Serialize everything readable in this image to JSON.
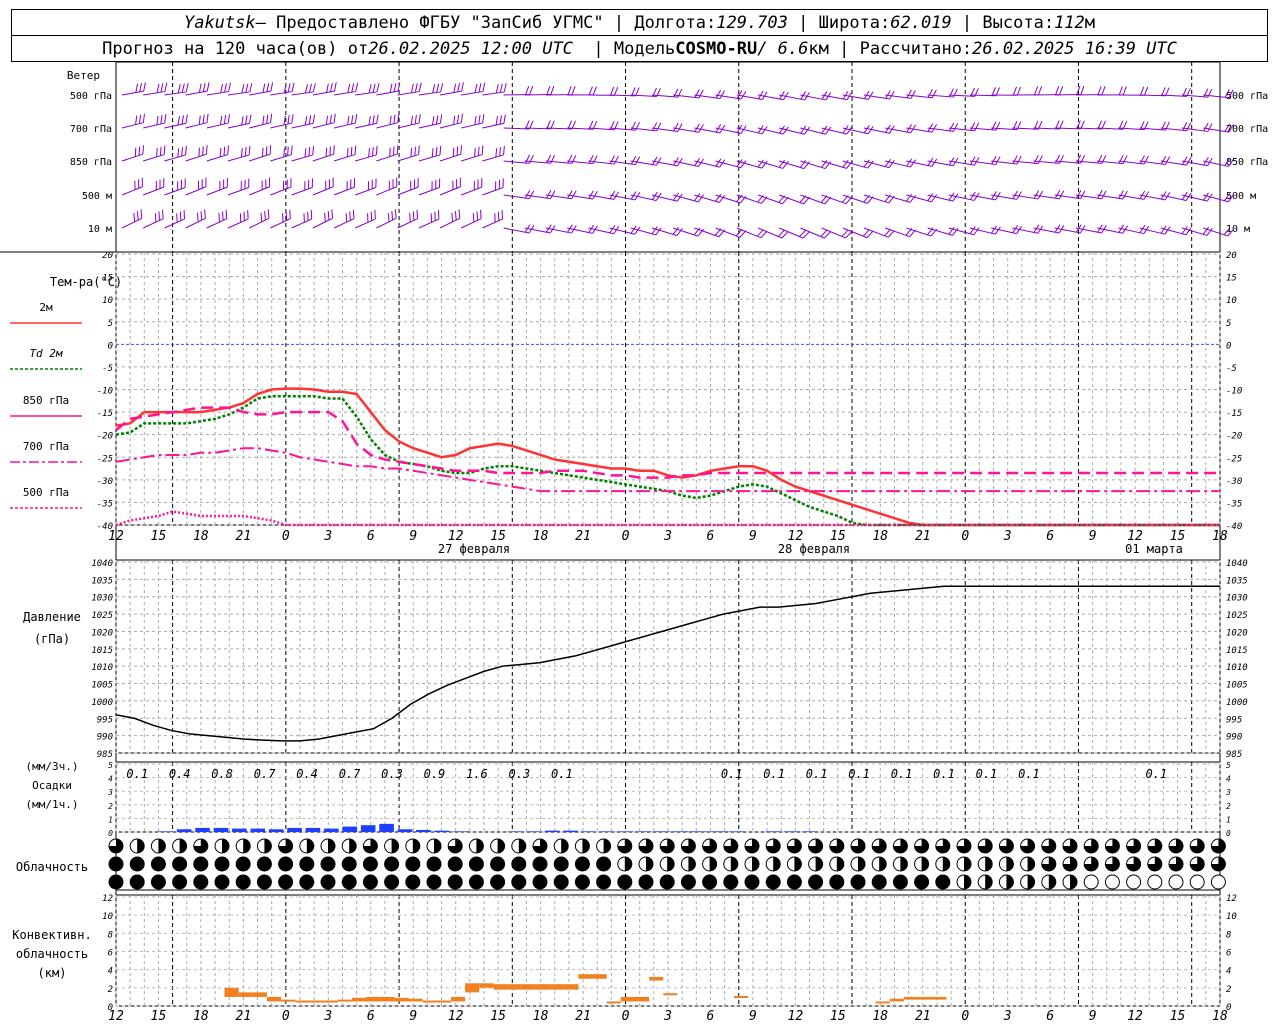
{
  "header": {
    "station": "Yakutsk",
    "provided_by": "— Предоставлено ФГБУ \"ЗапСиб УГМС\"",
    "lon_label": "Долгота:",
    "lon_value": "129.703",
    "lat_label": "Широта:",
    "lat_value": "62.019",
    "alt_label": "Высота:",
    "alt_value": "112",
    "alt_unit": "м",
    "forecast_label": "Прогноз на 120 часа(ов) от",
    "forecast_start": "26.02.2025 12:00 UTC",
    "model_label": "Модель",
    "model_name": "COSMO-RU",
    "model_res": "/ 6.6",
    "model_res_unit": "км",
    "calc_label": "Рассчитано:",
    "calc_time": "26.02.2025 16:39 UTC"
  },
  "colors": {
    "t2m": "#ff3333",
    "td2m": "#008000",
    "t850": "#ff1493",
    "t700": "#ff1493",
    "t500": "#ff1493",
    "pressure": "#000000",
    "precip": "#1f3fff",
    "convective": "#f08020",
    "wind": "#8800cc",
    "zero_line": "#3355ff"
  },
  "wind_panel": {
    "title": "Ветер",
    "levels": [
      "500 гПа",
      "700 гПа",
      "850 гПа",
      "500 м",
      "10  м"
    ],
    "right_levels": [
      "500 гПа",
      "700 гПа",
      "850 гПа",
      "500 м",
      "10  м"
    ]
  },
  "temp_legend": {
    "title": "Тем-ра(°C)",
    "items": [
      "2м",
      "Td  2м",
      "850 гПа",
      "700 гПа",
      "500 гПа"
    ]
  },
  "pressure_panel": {
    "title1": "Давление",
    "title2": "(гПа)"
  },
  "precip_panel": {
    "unit3h": "(мм/3ч.)",
    "title": "Осадки",
    "unit1h": "(мм/1ч.)"
  },
  "cloud_panel": {
    "title": "Облачность"
  },
  "conv_panel": {
    "title1": "Конвективн.",
    "title2": "облачность",
    "title3": "(км)"
  },
  "time_axis": {
    "hour_labels": [
      "12",
      "15",
      "18",
      "21",
      "0",
      "3",
      "6",
      "9",
      "12",
      "15",
      "18",
      "21",
      "0",
      "3",
      "6",
      "9",
      "12",
      "15",
      "18",
      "21",
      "0",
      "3",
      "6",
      "9",
      "12",
      "15",
      "18"
    ],
    "date_labels": [
      "27 февраля",
      "28 февраля",
      "01 марта"
    ]
  },
  "precip_3h_labels": [
    "0.1",
    "0.4",
    "0.8",
    "0.7",
    "0.4",
    "0.7",
    "0.3",
    "0.9",
    "1.6",
    "0.3",
    "0.1",
    "",
    "",
    "",
    "0.1",
    "0.1",
    "0.1",
    "0.1",
    "0.1",
    "0.1",
    "0.1",
    "0.1",
    "",
    "",
    "0.1",
    "",
    ""
  ],
  "chart_data": [
    {
      "type": "line",
      "name": "temperature",
      "x_hours": [
        0,
        3,
        6,
        9,
        12,
        15,
        18,
        21,
        24,
        27,
        30,
        33,
        36,
        39,
        42,
        45,
        48,
        51,
        54,
        57,
        60,
        63,
        66,
        69,
        72,
        75,
        78,
        81,
        84,
        87,
        90,
        93,
        96,
        99,
        102,
        105,
        108,
        111,
        114,
        117,
        120,
        123,
        126,
        129,
        132,
        135,
        138,
        141,
        144,
        147,
        150,
        153,
        156,
        159,
        162,
        165,
        168,
        171,
        174,
        177,
        180,
        183,
        186,
        189,
        192,
        195,
        198,
        201,
        204,
        207,
        210,
        213,
        216,
        219,
        222,
        225,
        228,
        231,
        234
      ],
      "ylim": [
        -40,
        20
      ],
      "yticks": [
        20,
        15,
        10,
        5,
        0,
        -5,
        -10,
        -15,
        -20,
        -25,
        -30,
        -35,
        -40
      ],
      "series": [
        {
          "name": "2м",
          "values": [
            -18,
            -17.5,
            -15,
            -15,
            -15,
            -15,
            -15,
            -14.5,
            -14,
            -13,
            -11,
            -10,
            -9.8,
            -9.8,
            -10,
            -10.5,
            -10.5,
            -11,
            -15,
            -19,
            -21.5,
            -23,
            -24,
            -25,
            -24.5,
            -23,
            -22.5,
            -22,
            -22.5,
            -23.5,
            -24.5,
            -25.5,
            -26,
            -26.5,
            -27,
            -27.5,
            -27.5,
            -28,
            -28,
            -29,
            -29.5,
            -29,
            -28,
            -27.5,
            -27,
            -27,
            -28,
            -30,
            -31.5,
            -32.5,
            -33.5,
            -34.5,
            -35.5,
            -36.5,
            -37.5,
            -38.5,
            -39.5,
            -40,
            -40,
            -40,
            -40,
            -40,
            -40,
            -40,
            -40,
            -40,
            -40,
            -40,
            -40,
            -40,
            -40,
            -40,
            -40,
            -40,
            -40,
            -40,
            -40,
            -40,
            -40
          ]
        },
        {
          "name": "Td  2м",
          "values": [
            -20,
            -19.5,
            -17.5,
            -17.5,
            -17.5,
            -17.5,
            -17,
            -16.5,
            -15.5,
            -14,
            -12,
            -11.5,
            -11.5,
            -11.5,
            -11.5,
            -12,
            -12,
            -16,
            -21,
            -24.5,
            -26,
            -26.5,
            -27,
            -28,
            -28.5,
            -28.5,
            -27.5,
            -27,
            -27,
            -27.5,
            -28,
            -28.5,
            -29,
            -29.5,
            -30,
            -30.5,
            -31,
            -31.5,
            -32,
            -32.5,
            -33.5,
            -34,
            -33.5,
            -32.5,
            -31.5,
            -31,
            -31.5,
            -33,
            -34.5,
            -36,
            -37,
            -38,
            -39.5,
            -40,
            -40,
            -40,
            -40,
            -40,
            -40,
            -40,
            -40,
            -40,
            -40,
            -40,
            -40,
            -40,
            -40,
            -40,
            -40,
            -40,
            -40,
            -40,
            -40,
            -40,
            -40,
            -40,
            -40,
            -40,
            -40
          ]
        },
        {
          "name": "850 гПа",
          "values": [
            -19,
            -16.5,
            -16,
            -15.5,
            -15,
            -14.5,
            -14,
            -14,
            -14,
            -15,
            -15.5,
            -15.5,
            -15,
            -15,
            -15,
            -15,
            -17,
            -22,
            -24.5,
            -25.5,
            -26,
            -26.5,
            -27,
            -27.5,
            -28,
            -28,
            -28,
            -28.5,
            -28.5,
            -28.5,
            -28.5,
            -28,
            -28,
            -28,
            -28.5,
            -29,
            -29,
            -29.5,
            -29.5,
            -29.5,
            -29,
            -29,
            -28.5,
            -28.5,
            -28.5,
            -28.5,
            -28.5,
            -28.5,
            -28.5,
            -28.5,
            -28.5,
            -28.5,
            -28.5,
            -28.5,
            -28.5,
            -28.5,
            -28.5,
            -28.5,
            -28.5,
            -28.5,
            -28.5,
            -28.5,
            -28.5,
            -28.5,
            -28.5,
            -28.5,
            -28.5,
            -28.5,
            -28.5,
            -28.5,
            -28.5,
            -28.5,
            -28.5,
            -28.5,
            -28.5,
            -28.5,
            -28.5,
            -28.5,
            -28.5
          ]
        },
        {
          "name": "700 гПа",
          "values": [
            -26,
            -25.5,
            -25,
            -24.5,
            -24.5,
            -24.5,
            -24,
            -24,
            -23.5,
            -23,
            -23,
            -23.5,
            -24,
            -25,
            -25.5,
            -26,
            -26.5,
            -27,
            -27,
            -27.5,
            -27.5,
            -28,
            -28.5,
            -29,
            -29.5,
            -30,
            -30.5,
            -31,
            -31.5,
            -32,
            -32.5,
            -32.5,
            -32.5,
            -32.5,
            -32.5,
            -32.5,
            -32.5,
            -32.5,
            -32.5,
            -32.5,
            -32.5,
            -32.5,
            -32.5,
            -32.5,
            -32.5,
            -32.5,
            -32.5,
            -32.5,
            -32.5,
            -32.5,
            -32.5,
            -32.5,
            -32.5,
            -32.5,
            -32.5,
            -32.5,
            -32.5,
            -32.5,
            -32.5,
            -32.5,
            -32.5,
            -32.5,
            -32.5,
            -32.5,
            -32.5,
            -32.5,
            -32.5,
            -32.5,
            -32.5,
            -32.5,
            -32.5,
            -32.5,
            -32.5,
            -32.5,
            -32.5,
            -32.5,
            -32.5,
            -32.5,
            -32.5
          ]
        },
        {
          "name": "500 гПа",
          "values": [
            -40,
            -39,
            -38.5,
            -38,
            -37,
            -37.5,
            -38,
            -38,
            -38,
            -38,
            -38.5,
            -39,
            -40,
            -40,
            -40,
            -40,
            -40,
            -40,
            -40,
            -40,
            -40,
            -40,
            -40,
            -40,
            -40,
            -40,
            -40,
            -40,
            -40,
            -40,
            -40,
            -40,
            -40,
            -40,
            -40,
            -40,
            -40,
            -40,
            -40,
            -40,
            -40,
            -40,
            -40,
            -40,
            -40,
            -40,
            -40,
            -40,
            -40,
            -40,
            -40,
            -40,
            -40,
            -40,
            -40,
            -40,
            -40,
            -40,
            -40,
            -40,
            -40,
            -40,
            -40,
            -40,
            -40,
            -40,
            -40,
            -40,
            -40,
            -40,
            -40,
            -40,
            -40,
            -40,
            -40,
            -40,
            -40,
            -40,
            -40
          ]
        }
      ]
    },
    {
      "type": "line",
      "name": "pressure",
      "x_hours": [
        0,
        3,
        6,
        9,
        12,
        15,
        18,
        21,
        24,
        27,
        30,
        33,
        36,
        39,
        42,
        45,
        48,
        51,
        54,
        57,
        60,
        63,
        66,
        69,
        72,
        75,
        78,
        81,
        84,
        87,
        90,
        93,
        96,
        99,
        102,
        105,
        108,
        111,
        114,
        117,
        120,
        123,
        126,
        129,
        132,
        135,
        138,
        141,
        144,
        147,
        150,
        153,
        156,
        159,
        162,
        165,
        168,
        171,
        174,
        177,
        180
      ],
      "ylim": [
        985,
        1040
      ],
      "yticks": [
        1040,
        1035,
        1030,
        1025,
        1020,
        1015,
        1010,
        1005,
        1000,
        995,
        990,
        985
      ],
      "values": [
        996,
        995,
        993,
        991.5,
        990.5,
        990,
        989.5,
        989,
        988.7,
        988.5,
        988.5,
        989,
        990,
        991,
        992,
        995,
        999,
        1002,
        1004.5,
        1006.5,
        1008.5,
        1010,
        1010.5,
        1011,
        1012,
        1013,
        1014.5,
        1016,
        1017.5,
        1019,
        1020.5,
        1022,
        1023.5,
        1025,
        1026,
        1027,
        1027,
        1027.5,
        1028,
        1029,
        1030,
        1031,
        1031.5,
        1032,
        1032.5,
        1033,
        1033,
        1033,
        1033,
        1033,
        1033,
        1033,
        1033,
        1033,
        1033,
        1033,
        1033,
        1033,
        1033,
        1033,
        1033
      ]
    },
    {
      "type": "bar",
      "name": "precipitation_1h",
      "ylim": [
        0,
        5
      ],
      "x_hours": [
        0,
        3,
        6,
        9,
        12,
        15,
        18,
        21,
        24,
        27,
        30,
        33,
        36,
        39,
        42,
        45,
        48,
        51,
        54,
        57,
        60,
        63,
        66,
        69,
        72,
        75,
        78,
        81,
        84,
        87,
        90,
        93,
        96,
        99,
        102,
        105,
        108,
        111,
        114,
        117
      ],
      "values": [
        0.05,
        0.2,
        0.3,
        0.3,
        0.25,
        0.25,
        0.2,
        0.3,
        0.3,
        0.25,
        0.4,
        0.5,
        0.6,
        0.2,
        0.15,
        0.1,
        0.05,
        0.0,
        0.0,
        0.05,
        0.05,
        0.1,
        0.1,
        0.05,
        0.05,
        0.05,
        0.05,
        0.05,
        0.05,
        0.05,
        0.05,
        0.05,
        0.0,
        0.05,
        0.05,
        0.05,
        0.0,
        0.0,
        0.0,
        0.0
      ]
    },
    {
      "type": "bar",
      "name": "convective_cloud_km",
      "ylim": [
        0,
        12
      ],
      "x_hours": [
        2,
        4,
        6,
        8,
        10,
        12,
        14,
        16,
        18,
        20,
        22,
        24,
        26,
        28,
        30,
        32,
        34,
        36,
        38,
        40,
        42,
        44,
        46,
        48,
        50,
        52,
        54,
        56,
        58,
        60,
        62,
        64,
        66,
        68,
        70,
        72,
        74,
        76,
        78,
        80,
        82,
        84,
        86,
        88,
        90,
        92,
        94,
        96,
        98,
        100,
        102,
        104,
        106,
        108,
        110,
        112,
        114,
        116,
        118,
        120,
        122,
        124,
        126,
        128,
        130,
        132,
        134,
        136
      ],
      "ranges": [
        [
          1,
          2
        ],
        [
          1,
          1.5
        ],
        [
          1,
          1.5
        ],
        [
          0.5,
          1
        ],
        [
          0.5,
          0.7
        ],
        [
          0.5,
          0.6
        ],
        [
          0.5,
          0.6
        ],
        [
          0.5,
          0.6
        ],
        [
          0.5,
          0.7
        ],
        [
          0.5,
          0.9
        ],
        [
          0.5,
          1
        ],
        [
          0.5,
          1
        ],
        [
          0.5,
          0.9
        ],
        [
          0.5,
          0.8
        ],
        [
          0.5,
          0.6
        ],
        [
          0.5,
          0.6
        ],
        [
          0.5,
          1
        ],
        [
          1.5,
          2.5
        ],
        [
          2,
          2.5
        ],
        [
          1.8,
          2.4
        ],
        [
          1.8,
          2.4
        ],
        [
          1.8,
          2.4
        ],
        [
          1.8,
          2.4
        ],
        [
          1.8,
          2.4
        ],
        [
          1.8,
          2.4
        ],
        [
          3,
          3.5
        ],
        [
          3,
          3.5
        ],
        [
          0.3,
          0.5
        ],
        [
          0.5,
          1
        ],
        [
          0.5,
          1
        ],
        [
          2.8,
          3.2
        ],
        [
          1.2,
          1.4
        ],
        [
          0,
          0
        ],
        [
          0,
          0
        ],
        [
          0,
          0
        ],
        [
          0,
          0
        ],
        [
          0.9,
          1.1
        ],
        [
          0,
          0
        ],
        [
          0,
          0
        ],
        [
          0,
          0
        ],
        [
          0,
          0
        ],
        [
          0,
          0
        ],
        [
          0,
          0
        ],
        [
          0,
          0
        ],
        [
          0,
          0
        ],
        [
          0,
          0
        ],
        [
          0.3,
          0.5
        ],
        [
          0.5,
          0.8
        ],
        [
          0.7,
          1
        ],
        [
          0.7,
          1
        ],
        [
          0.7,
          1
        ],
        [
          0,
          0
        ],
        [
          0,
          0
        ],
        [
          0,
          0
        ],
        [
          0,
          0
        ],
        [
          0,
          0
        ],
        [
          0,
          0
        ],
        [
          0,
          0
        ],
        [
          0,
          0
        ],
        [
          0,
          0
        ],
        [
          0,
          0
        ],
        [
          0,
          0
        ],
        [
          0,
          0
        ],
        [
          0,
          0
        ],
        [
          0,
          0
        ],
        [
          0,
          0
        ],
        [
          0,
          0
        ],
        [
          0,
          0
        ]
      ]
    }
  ]
}
